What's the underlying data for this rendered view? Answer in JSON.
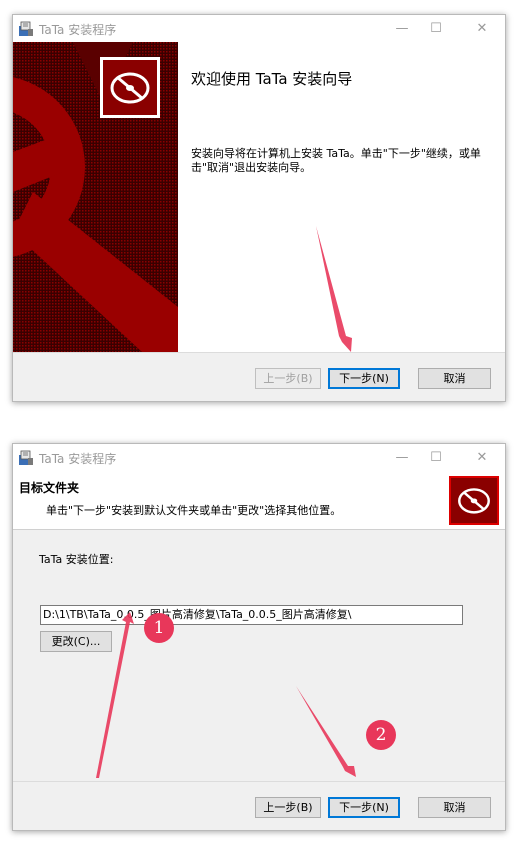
{
  "window1": {
    "title": "TaTa 安装程序",
    "heading": "欢迎使用 TaTa 安装向导",
    "description": "安装向导将在计算机上安装 TaTa。单击\"下一步\"继续，或单击\"取消\"退出安装向导。",
    "buttons": {
      "back": "上一步(B)",
      "next": "下一步(N)",
      "cancel": "取消"
    }
  },
  "window2": {
    "title": "TaTa 安装程序",
    "heading": "目标文件夹",
    "subheading": "单击\"下一步\"安装到默认文件夹或单击\"更改\"选择其他位置。",
    "location_label": "TaTa 安装位置:",
    "path_value": "D:\\1\\TB\\TaTa_0.0.5_图片高清修复\\TaTa_0.0.5_图片高清修复\\",
    "change_button": "更改(C)...",
    "buttons": {
      "back": "上一步(B)",
      "next": "下一步(N)",
      "cancel": "取消"
    }
  },
  "annotations": {
    "badge1": "1",
    "badge2": "2"
  },
  "icons": {
    "window_controls": [
      "minimize-icon",
      "maximize-icon",
      "close-icon"
    ],
    "app_icon": "installer-icon",
    "logo": "disc-logo-icon"
  },
  "colors": {
    "banner_red": "#8a0000",
    "accent_blue": "#0078d7",
    "annotation_pink": "#e8375a"
  }
}
